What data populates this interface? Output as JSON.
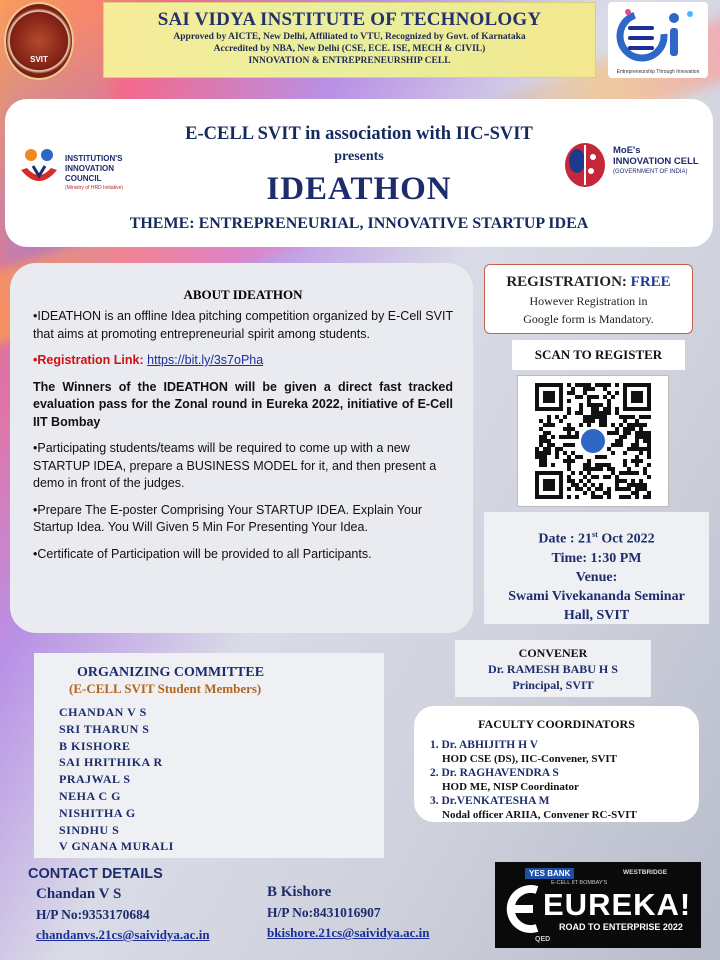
{
  "institute": {
    "name": "SAI VIDYA INSTITUTE OF TECHNOLOGY",
    "lines": [
      "Approved by AICTE, New Delhi, Affiliated to VTU, Recognized by Govt. of Karnataka",
      "Accredited by NBA, New Delhi  (CSE, ECE. ISE, MECH & CIVIL)",
      "INNOVATION & ENTREPRENEURSHIP CELL"
    ],
    "seal_text": "SVIT",
    "ecell_caption": "Entrepreneurship Through Innovation"
  },
  "banner": {
    "line1": "E-CELL SVIT  in association with IIC-SVIT",
    "line2": "presents",
    "title": "IDEATHON",
    "theme": "THEME: ENTREPRENEURIAL, INNOVATIVE STARTUP IDEA",
    "iic_logo": {
      "lines": [
        "INSTITUTION'S",
        "INNOVATION",
        "COUNCIL"
      ],
      "sub": "(Ministry of HRD Initiative)"
    },
    "moe_logo": {
      "lines": [
        "MoE's",
        "INNOVATION CELL"
      ],
      "sub": "(GOVERNMENT OF INDIA)"
    }
  },
  "about": {
    "title": "ABOUT IDEATHON",
    "p1": "•IDEATHON is an offline Idea pitching competition organized by E-Cell SVIT that aims at promoting entrepreneurial spirit among students.",
    "reg_bullet": "•",
    "reg_label": "Registration Link:",
    "reg_link": "https://bit.ly/3s7oPha",
    "p_winners": "The Winners of the IDEATHON will be given a direct fast tracked evaluation pass for the Zonal round in Eureka 2022,  initiative of  E-Cell IIT Bombay",
    "p3": "•Participating students/teams will be required to come up with a new STARTUP IDEA, prepare a BUSINESS MODEL for it, and then present a demo in front of the judges.",
    "p4": "•Prepare The E-poster Comprising Your STARTUP IDEA. Explain Your Startup Idea. You Will Given 5 Min For Presenting Your Idea.",
    "p5": "•Certificate of Participation will be provided to all Participants."
  },
  "registration": {
    "label": "REGISTRATION: ",
    "value": "FREE",
    "note1": "However Registration in",
    "note2": "Google form is Mandatory."
  },
  "scan_label": "SCAN TO REGISTER",
  "event": {
    "date_label": "Date : ",
    "date_day": "21",
    "date_suffix": "st",
    "date_rest": "  Oct 2022",
    "time": "Time: 1:30 PM",
    "venue_label": "Venue:",
    "venue_line1": "Swami Vivekananda Seminar",
    "venue_line2": "Hall, SVIT"
  },
  "convener": {
    "title": "CONVENER",
    "name": "Dr. RAMESH BABU H S",
    "role": "Principal, SVIT"
  },
  "faculty": {
    "title": "FACULTY COORDINATORS",
    "items": [
      {
        "name": "1. Dr. ABHIJITH H V",
        "role": "HOD CSE (DS), IIC-Convener,  SVIT"
      },
      {
        "name": "2. Dr. RAGHAVENDRA S",
        "role": "HOD ME, NISP Coordinator"
      },
      {
        "name": "3. Dr.VENKATESHA M",
        "role": "Nodal officer ARIIA, Convener  RC-SVIT"
      }
    ]
  },
  "committee": {
    "title": "ORGANIZING COMMITTEE",
    "subtitle": "(E-CELL SVIT Student Members)",
    "members": [
      "CHANDAN V S",
      "SRI THARUN S",
      "B KISHORE",
      "SAI HRITHIKA R",
      "PRAJWAL S",
      "NEHA C G",
      "NISHITHA G",
      "SINDHU S",
      "V GNANA MURALI"
    ]
  },
  "contact": {
    "title": "CONTACT DETAILS",
    "people": [
      {
        "name": "Chandan V S",
        "phone": "H/P No:9353170684",
        "email": "chandanvs.21cs@saividya.ac.in"
      },
      {
        "name": "B Kishore",
        "phone": "H/P No:8431016907",
        "email": "bkishore.21cs@saividya.ac.in"
      }
    ]
  },
  "eureka": {
    "word": "EUREKA!",
    "sub": "ROAD TO ENTERPRISE 2022",
    "sponsor": "YES BANK",
    "partner": "WESTBRIDGE",
    "tag": "E-CELL IIT BOMBAY'S",
    "qed": "QED"
  },
  "colors": {
    "navy": "#1d2c6c",
    "link": "#1a2f9a",
    "red": "#d11111",
    "orange": "#b5651d",
    "header_band": "#f3e78f"
  }
}
